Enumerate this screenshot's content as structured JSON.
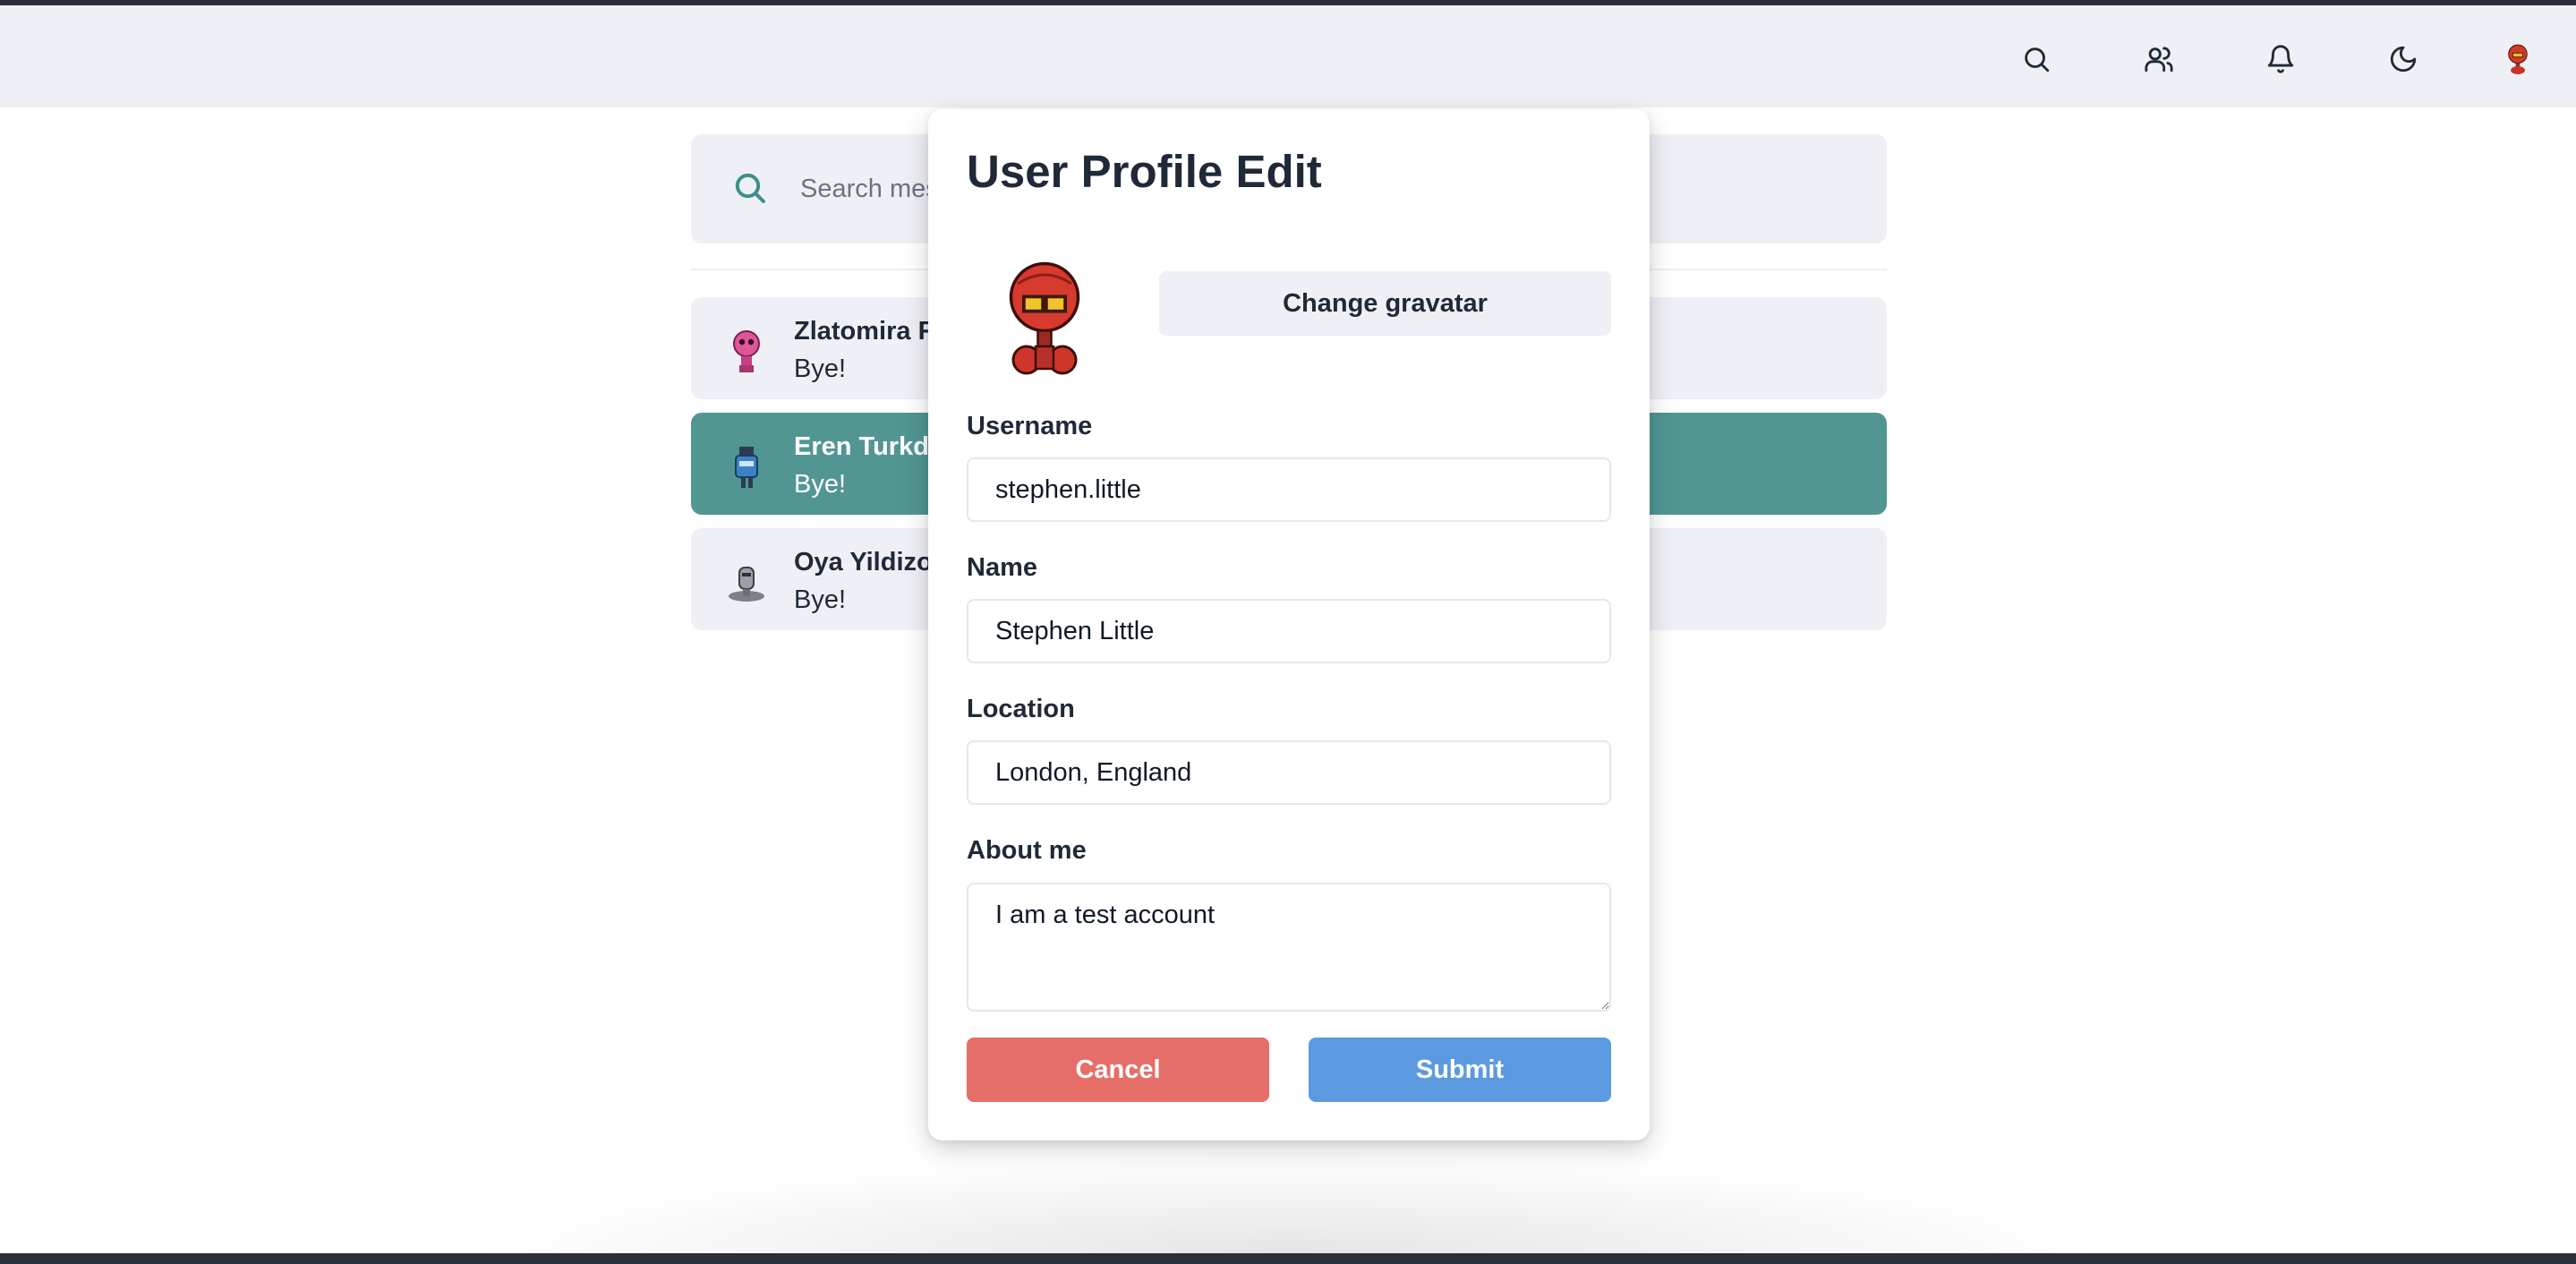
{
  "navbar": {
    "icons": [
      "search-icon",
      "users-icon",
      "bell-icon",
      "moon-icon",
      "user-avatar"
    ]
  },
  "search": {
    "placeholder": "Search messages"
  },
  "chats": [
    {
      "name": "Zlatomira R",
      "message": "Bye!",
      "active": false
    },
    {
      "name": "Eren Turkdo",
      "message": "Bye!",
      "active": true
    },
    {
      "name": "Oya Yildizo",
      "message": "Bye!",
      "active": false
    }
  ],
  "modal": {
    "title": "User Profile Edit",
    "change_gravatar_label": "Change gravatar",
    "fields": {
      "username": {
        "label": "Username",
        "value": "stephen.little"
      },
      "name": {
        "label": "Name",
        "value": "Stephen Little"
      },
      "location": {
        "label": "Location",
        "value": "London, England"
      },
      "about": {
        "label": "About me",
        "value": "I am a test account"
      }
    },
    "cancel_label": "Cancel",
    "submit_label": "Submit"
  },
  "colors": {
    "accent": "#519693",
    "cancel": "#e66e68",
    "submit": "#5b9ae0",
    "surface": "#eef0f5"
  }
}
